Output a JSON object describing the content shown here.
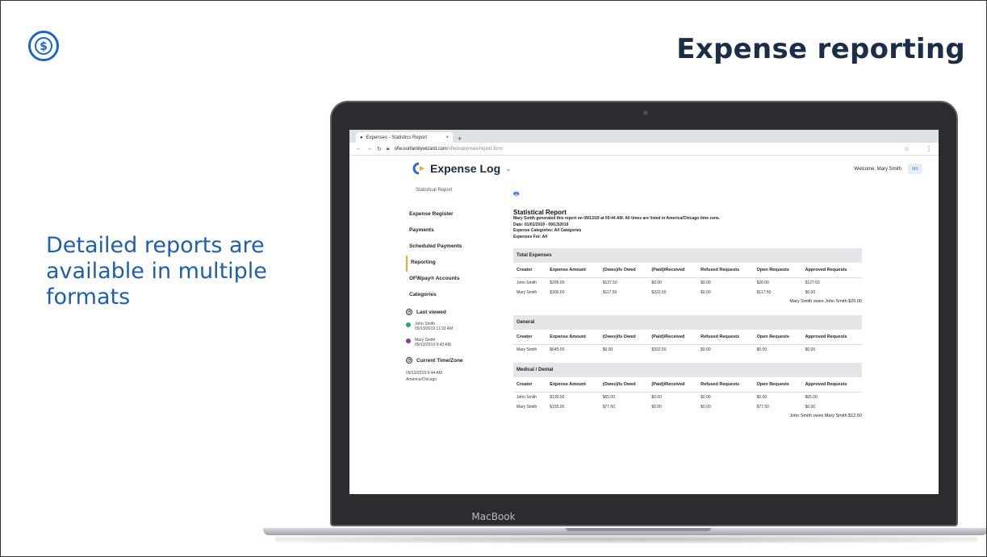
{
  "slide": {
    "title": "Expense reporting",
    "subtitle": "Detailed reports are available in multiple formats",
    "logo_icon": "dollar-sign-icon",
    "accent": "#1f5fae"
  },
  "laptop": {
    "label": "MacBook"
  },
  "browser": {
    "tab_title": "Expenses - Statistics Report",
    "tab_close": "×",
    "new_tab": "+",
    "url_host": "ofw.ourfamilywizard.com",
    "url_path": "/ofw/expenses/report.form"
  },
  "app": {
    "name": "Expense Log",
    "welcome": "Welcome, Mary Smith",
    "avatar": "MS",
    "sidebar": {
      "header": "Statistical Report",
      "items": [
        {
          "label": "Expense Register"
        },
        {
          "label": "Payments"
        },
        {
          "label": "Scheduled Payments"
        },
        {
          "label": "Reporting"
        },
        {
          "label": "OFWpay® Accounts"
        },
        {
          "label": "Categories"
        }
      ],
      "last_viewed_label": "Last viewed",
      "recent": [
        {
          "name": "John Smith",
          "time": "09/13/2019 11:32 AM",
          "color": "#2aa87a"
        },
        {
          "name": "Mary Smith",
          "time": "09/13/2019 9:43 AM",
          "color": "#8e3b8c"
        }
      ],
      "tz_label": "Current Time/Zone",
      "tz_time": "09/13/2019 9:44 AM",
      "tz_zone": "America/Chicago"
    },
    "report": {
      "title": "Statistical Report",
      "generated": "Mary Smith generated this report on 09/13/19 at 09:44 AM. All times are listed in America/Chicago time zone.",
      "date": "Date:  01/01/2019 - 09/13/2019",
      "categories": "Expense Categories: All Categories",
      "for": "Expenses For: All",
      "columns": [
        "Creator",
        "Expense Amount",
        "(Owes)/Is Owed",
        "(Paid)/Received",
        "Refused Requests",
        "Open Requests",
        "Approved Requests"
      ],
      "sections": [
        {
          "name": "Total Expenses",
          "rows": [
            [
              "John Smith",
              "$295.00",
              "$137.50",
              "$0.00",
              "$0.00",
              "$20.00",
              "$127.50"
            ],
            [
              "Mary Smith",
              "$300.00",
              "$117.50",
              "$322.50",
              "$0.00",
              "$117.50",
              "$0.00"
            ]
          ],
          "summary": "Mary Smith owes John Smith $20.00"
        },
        {
          "name": "General",
          "rows": [
            [
              "Mary Smith",
              "$645.00",
              "$0.00",
              "$322.50",
              "$0.00",
              "$0.00",
              "$0.00"
            ]
          ],
          "summary": ""
        },
        {
          "name": "Medical / Dental",
          "rows": [
            [
              "John Smith",
              "$130.00",
              "$65.00",
              "$0.00",
              "$0.00",
              "$0.00",
              "$65.00"
            ],
            [
              "Mary Smith",
              "$155.00",
              "$77.50",
              "$0.00",
              "$0.00",
              "$77.50",
              "$0.00"
            ]
          ],
          "summary": "John Smith owes Mary Smith $12.50"
        }
      ]
    }
  }
}
